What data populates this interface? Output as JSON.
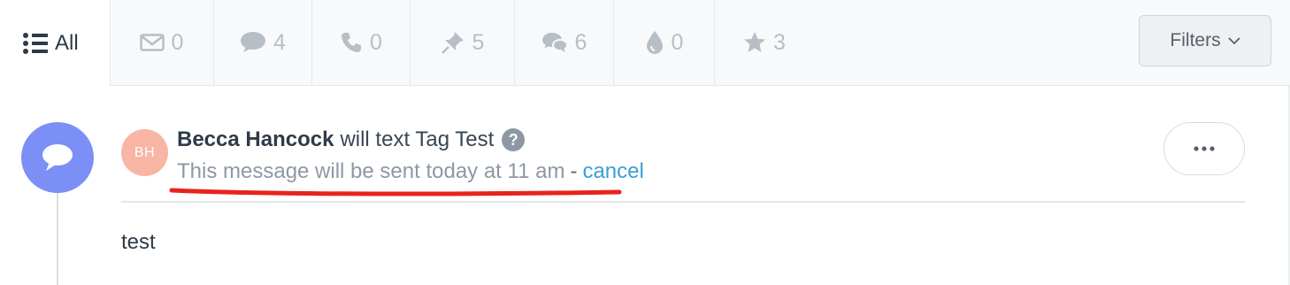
{
  "tabs": {
    "all": {
      "label": "All",
      "icon": "list-icon"
    },
    "items": [
      {
        "icon": "envelope-icon",
        "count": "0"
      },
      {
        "icon": "chat-bubble-icon",
        "count": "4"
      },
      {
        "icon": "phone-icon",
        "count": "0"
      },
      {
        "icon": "pin-icon",
        "count": "5"
      },
      {
        "icon": "conversation-icon",
        "count": "6"
      },
      {
        "icon": "drop-icon",
        "count": "0"
      },
      {
        "icon": "star-icon",
        "count": "3"
      }
    ],
    "filters_label": "Filters"
  },
  "activity": {
    "avatar_initials": "BH",
    "author": "Becca Hancock",
    "action": "will text Tag Test",
    "schedule_text": "This message will be sent today at 11 am",
    "separator": "-",
    "cancel_label": "cancel",
    "message_body": "test"
  },
  "colors": {
    "timeline_icon_bg": "#7b8ff7",
    "avatar_bg": "#f8b5a3",
    "link": "#3a9fd6",
    "annotation": "#e8231c"
  }
}
